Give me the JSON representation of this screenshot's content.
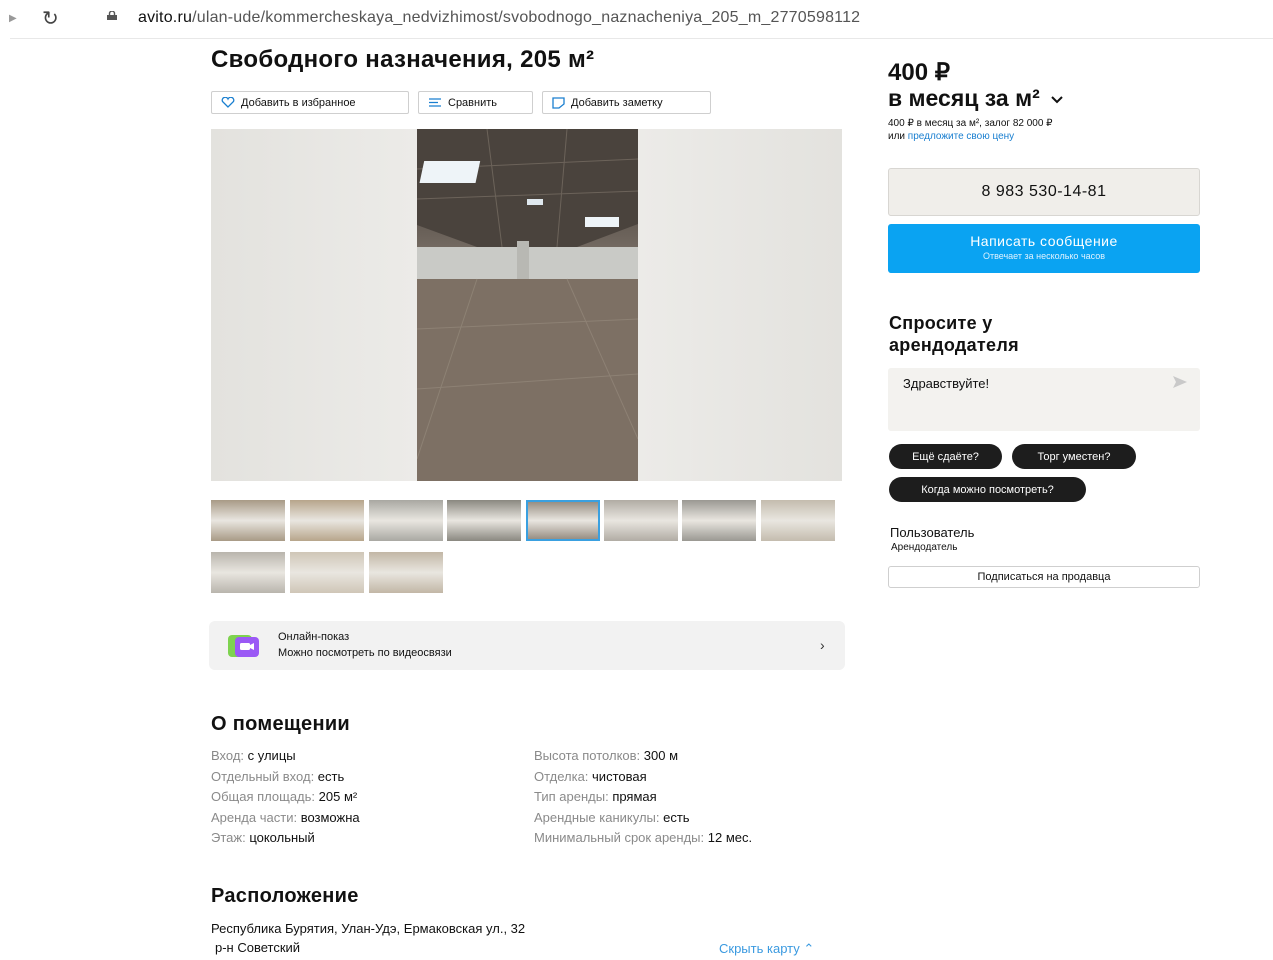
{
  "browser": {
    "url_host": "avito.ru",
    "url_path": "/ulan-ude/kommercheskaya_nedvizhimost/svobodnogo_naznacheniya_205_m_2770598112"
  },
  "listing": {
    "title": "Свободного назначения, 205 м²",
    "actions": {
      "favorite": "Добавить в избранное",
      "compare": "Сравнить",
      "note": "Добавить заметку"
    },
    "thumbnails": [
      {
        "color": "#a89a86"
      },
      {
        "color": "#b7a58b"
      },
      {
        "color": "#a9a8a2"
      },
      {
        "color": "#8a8880"
      },
      {
        "color": "#8f8579",
        "active": true
      },
      {
        "color": "#b1aca4"
      },
      {
        "color": "#9a9892"
      },
      {
        "color": "#c4bcae"
      },
      {
        "color": "#b9b5ad"
      },
      {
        "color": "#cfc6b7"
      },
      {
        "color": "#c2b7a6"
      }
    ],
    "online_show": {
      "title": "Онлайн-показ",
      "subtitle": "Можно посмотреть по видеосвязи",
      "chevron": "›"
    }
  },
  "about": {
    "title": "О помещении",
    "left": [
      {
        "k": "Вход:",
        "v": "с улицы"
      },
      {
        "k": "Отдельный вход:",
        "v": "есть"
      },
      {
        "k": "Общая площадь:",
        "v": "205 м²"
      },
      {
        "k": "Аренда части:",
        "v": "возможна"
      },
      {
        "k": "Этаж:",
        "v": "цокольный"
      }
    ],
    "right": [
      {
        "k": "Высота потолков:",
        "v": "300 м"
      },
      {
        "k": "Отделка:",
        "v": "чистовая"
      },
      {
        "k": "Тип аренды:",
        "v": "прямая"
      },
      {
        "k": "Арендные каникулы:",
        "v": "есть"
      },
      {
        "k": "Минимальный срок аренды:",
        "v": "12 мес."
      }
    ]
  },
  "location": {
    "title": "Расположение",
    "address": "Республика Бурятия, Улан-Удэ, Ермаковская ул., 32",
    "district": "р-н Советский",
    "hide_map": "Скрыть карту ⌃"
  },
  "sidebar": {
    "price": "400 ₽",
    "price_unit": "в месяц за м²",
    "price_note": "400 ₽ в месяц за м², залог 82 000 ₽",
    "price_offer_prefix": "или ",
    "price_offer_link": "предложите свою цену",
    "phone": "8 983 530-14-81",
    "message_button": "Написать сообщение",
    "message_sub": "Отвечает за несколько часов",
    "ask_title": "Спросите у арендодателя",
    "ask_placeholder": "Здравствуйте!",
    "quick_questions": [
      "Ещё сдаёте?",
      "Торг уместен?",
      "Когда можно посмотреть?"
    ],
    "user_name": "Пользователь",
    "user_role": "Арендодатель",
    "subscribe": "Подписаться на продавца"
  },
  "colors": {
    "accent": "#0aa3f2",
    "link": "#1a7fd0",
    "chip": "#1d1d1d"
  }
}
